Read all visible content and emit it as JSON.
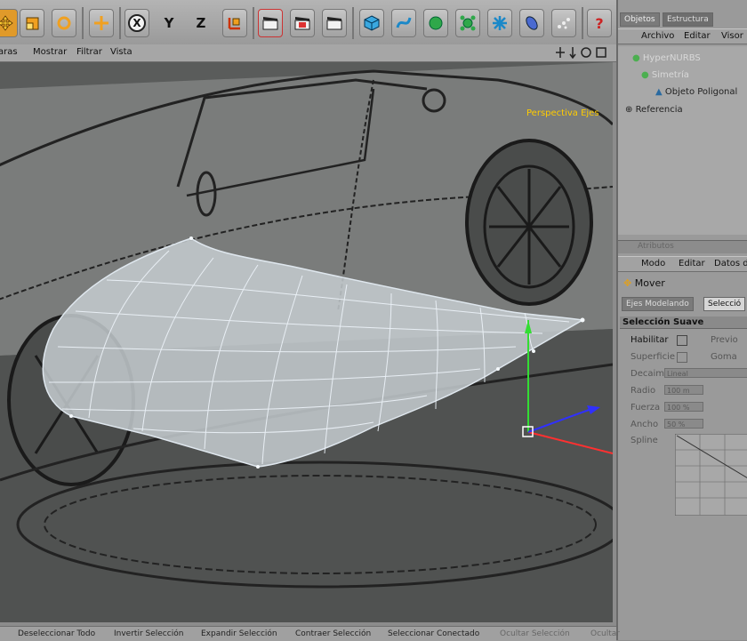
{
  "toolbar": {
    "buttons": [
      {
        "name": "move-tool-button",
        "icon": "move-icon"
      },
      {
        "name": "scale-tool-button",
        "icon": "scale-icon"
      },
      {
        "name": "rotate-tool-button",
        "icon": "rotate-icon"
      },
      {
        "name": "live-select-button",
        "icon": "crosshair-icon"
      },
      {
        "name": "x-axis-button",
        "label": "X"
      },
      {
        "name": "y-axis-button",
        "label": "Y"
      },
      {
        "name": "z-axis-button",
        "label": "Z"
      },
      {
        "name": "coordinate-system-button",
        "icon": "axis-icon"
      }
    ],
    "x_label": "X",
    "y_label": "Y",
    "z_label": "Z",
    "help_label": "?"
  },
  "viewport": {
    "menu": [
      "aras",
      "Mostrar",
      "Filtrar",
      "Vista"
    ],
    "camera_label": "Perspectiva Ejes"
  },
  "objects_panel": {
    "tabs": [
      "Objetos",
      "Estructura"
    ],
    "menu": [
      "Archivo",
      "Editar",
      "Visor"
    ],
    "tree": [
      "HyperNURBS",
      "Simetría",
      "Objeto Poligonal",
      "Referencia"
    ]
  },
  "attributes_panel": {
    "title": "Atributos",
    "menu": [
      "Modo",
      "Editar",
      "Datos d"
    ],
    "tool_name": "Mover",
    "tabs": [
      "Ejes Modelando",
      "Selecció"
    ],
    "section_title": "Selección Suave",
    "fields": {
      "habilitar": "Habilitar",
      "previo": "Previo",
      "superficie": "Superficie",
      "goma": "Goma",
      "decaimiento": "Decaimiento",
      "decaimiento_value": "Lineal",
      "radio": "Radio",
      "radio_value": "100 m",
      "fuerza": "Fuerza",
      "fuerza_value": "100 %",
      "ancho": "Ancho",
      "ancho_value": "50 %",
      "spline": "Spline"
    }
  },
  "statusbar": [
    "Deseleccionar Todo",
    "Invertir Selección",
    "Expandir Selección",
    "Contraer Selección",
    "Seleccionar Conectado",
    "Ocultar Selección",
    "Ocultar"
  ],
  "colors": {
    "selection": "#ffcc00",
    "x_axis": "#ff3030",
    "y_axis": "#33dd33",
    "z_axis": "#3030ff",
    "mesh": "#d0dde8"
  }
}
